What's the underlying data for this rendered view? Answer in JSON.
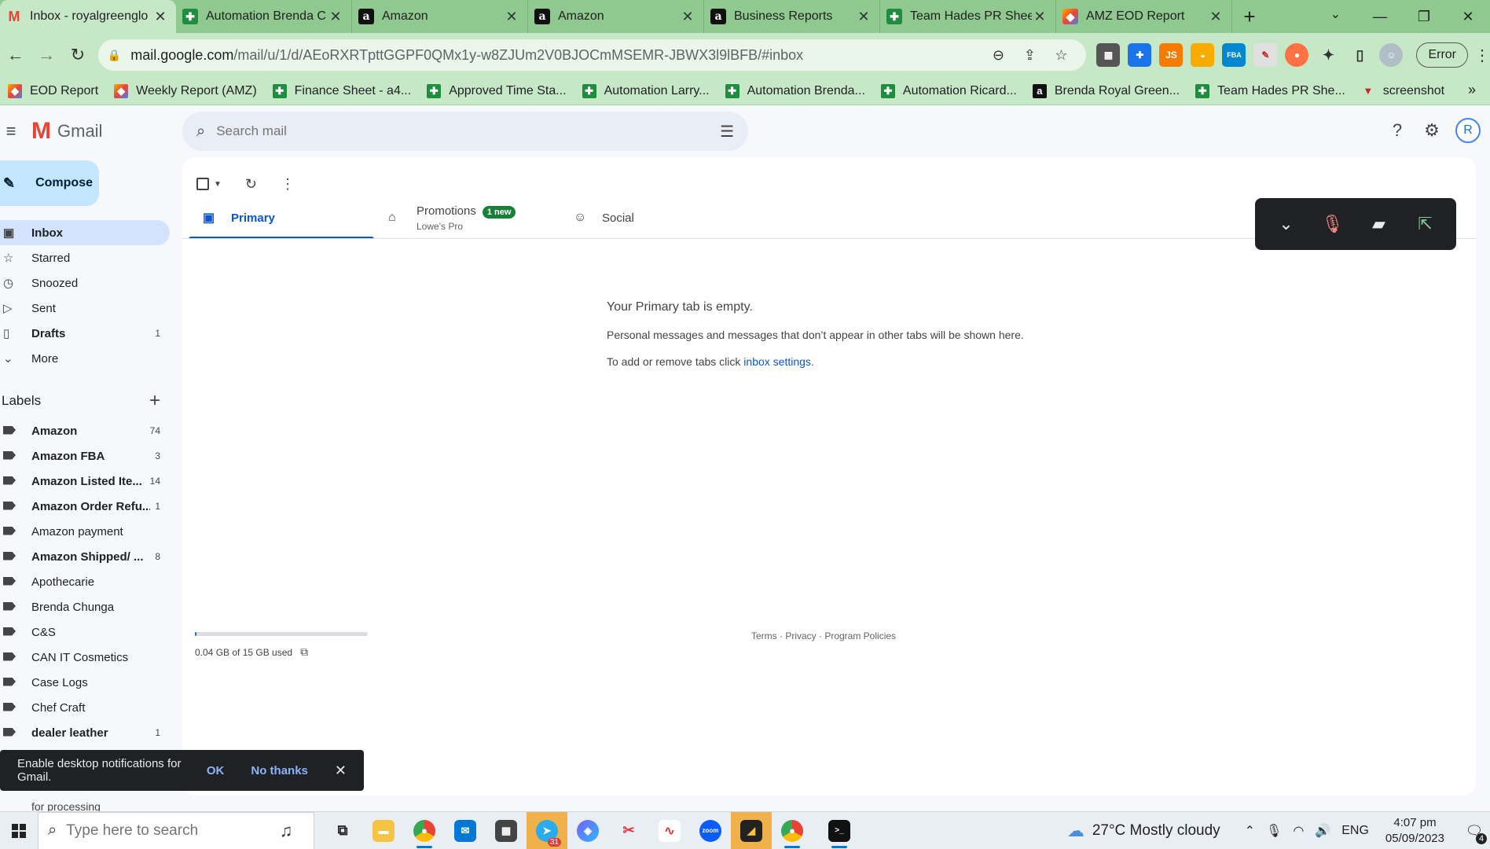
{
  "browser": {
    "tabs": [
      {
        "title": "Inbox - royalgreenglo",
        "icon": "gmail-icon",
        "active": true
      },
      {
        "title": "Automation Brenda C",
        "icon": "sheets-icon",
        "active": false
      },
      {
        "title": "Amazon",
        "icon": "amazon-icon",
        "active": false
      },
      {
        "title": "Amazon",
        "icon": "amazon-icon",
        "active": false
      },
      {
        "title": "Business Reports",
        "icon": "amazon-icon",
        "active": false
      },
      {
        "title": "Team Hades PR Sheet",
        "icon": "sheets-icon",
        "active": false
      },
      {
        "title": "AMZ EOD Report",
        "icon": "amz-report-icon",
        "active": false
      }
    ],
    "url_host": "mail.google.com",
    "url_path": "/mail/u/1/d/AEoRXRTpttGGPF0QMx1y-w8ZJUm2V0BJOCmMSEMR-JBWX3l9lBFB/#inbox",
    "error_label": "Error",
    "bookmarks": [
      {
        "label": "EOD Report",
        "icon": "amz-report-icon"
      },
      {
        "label": "Weekly Report (AMZ)",
        "icon": "amz-report-icon"
      },
      {
        "label": "Finance Sheet - a4...",
        "icon": "sheets-icon"
      },
      {
        "label": "Approved Time Sta...",
        "icon": "sheets-icon"
      },
      {
        "label": "Automation Larry...",
        "icon": "sheets-icon"
      },
      {
        "label": "Automation Brenda...",
        "icon": "sheets-icon"
      },
      {
        "label": "Automation Ricard...",
        "icon": "sheets-icon"
      },
      {
        "label": "Brenda Royal Green...",
        "icon": "amazon-icon"
      },
      {
        "label": "Team Hades PR She...",
        "icon": "sheets-icon"
      },
      {
        "label": "screenshot",
        "icon": "screenshot-icon"
      }
    ]
  },
  "gmail": {
    "logo_text": "Gmail",
    "search_placeholder": "Search mail",
    "avatar_letter": "R",
    "compose_label": "Compose",
    "nav": [
      {
        "label": "Inbox",
        "icon": "inbox-icon",
        "count": "",
        "active": true,
        "bold": true
      },
      {
        "label": "Starred",
        "icon": "star-icon",
        "count": "",
        "active": false,
        "bold": false
      },
      {
        "label": "Snoozed",
        "icon": "clock-icon",
        "count": "",
        "active": false,
        "bold": false
      },
      {
        "label": "Sent",
        "icon": "send-icon",
        "count": "",
        "active": false,
        "bold": false
      },
      {
        "label": "Drafts",
        "icon": "draft-icon",
        "count": "1",
        "active": false,
        "bold": true
      },
      {
        "label": "More",
        "icon": "chevron-down-icon",
        "count": "",
        "active": false,
        "bold": false
      }
    ],
    "labels_heading": "Labels",
    "labels": [
      {
        "name": "Amazon",
        "count": "74",
        "bold": true
      },
      {
        "name": "Amazon FBA",
        "count": "3",
        "bold": true
      },
      {
        "name": "Amazon Listed Ite...",
        "count": "14",
        "bold": true
      },
      {
        "name": "Amazon Order Refu...",
        "count": "1",
        "bold": true
      },
      {
        "name": "Amazon payment",
        "count": "",
        "bold": false
      },
      {
        "name": "Amazon Shipped/ ...",
        "count": "8",
        "bold": true
      },
      {
        "name": "Apothecarie",
        "count": "",
        "bold": false
      },
      {
        "name": "Brenda Chunga",
        "count": "",
        "bold": false
      },
      {
        "name": "C&S",
        "count": "",
        "bold": false
      },
      {
        "name": "CAN IT Cosmetics",
        "count": "",
        "bold": false
      },
      {
        "name": "Case Logs",
        "count": "",
        "bold": false
      },
      {
        "name": "Chef Craft",
        "count": "",
        "bold": false
      },
      {
        "name": "dealer leather",
        "count": "1",
        "bold": true
      }
    ],
    "peek_label": "for processing",
    "tabs": [
      {
        "label": "Primary",
        "sub": "",
        "badge": "",
        "icon": "inbox-tab-icon",
        "active": true
      },
      {
        "label": "Promotions",
        "sub": "Lowe's Pro",
        "badge": "1 new",
        "icon": "tag-icon",
        "active": false
      },
      {
        "label": "Social",
        "sub": "",
        "badge": "",
        "icon": "people-icon",
        "active": false
      }
    ],
    "empty": {
      "heading": "Your Primary tab is empty.",
      "line1": "Personal messages and messages that don’t appear in other tabs will be shown here.",
      "line2_prefix": "To add or remove tabs click ",
      "line2_link": "inbox settings",
      "line2_suffix": "."
    },
    "storage": {
      "text": "0.04 GB of 15 GB used",
      "fraction": 0.003
    },
    "footer": "Terms · Privacy · Program Policies",
    "snackbar": {
      "message": "Enable desktop notifications for Gmail.",
      "ok": "OK",
      "no": "No thanks"
    }
  },
  "taskbar": {
    "search_placeholder": "Type here to search",
    "weather": "27°C  Mostly cloudy",
    "lang": "ENG",
    "time": "4:07 pm",
    "date": "05/09/2023",
    "notif_count": "4",
    "telegram_badge": "31"
  }
}
